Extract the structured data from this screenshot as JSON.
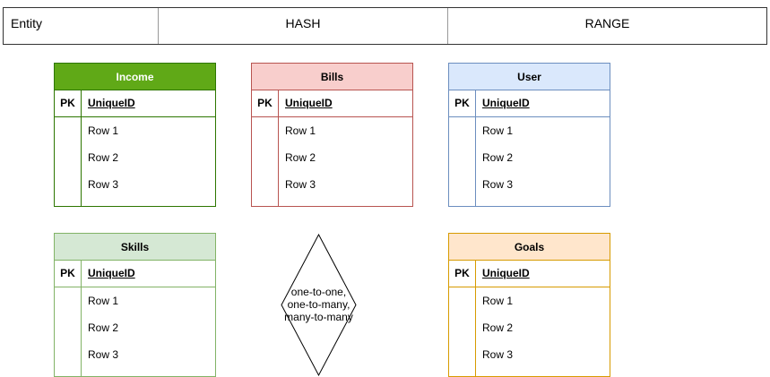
{
  "header": {
    "col1": "Entity",
    "col2": "HASH",
    "col3": "RANGE"
  },
  "entities": [
    {
      "title": "Income",
      "pk_label": "PK",
      "pk_field": "UniqueID",
      "rows": [
        "Row 1",
        "Row 2",
        "Row 3"
      ],
      "colors": {
        "fill": "#60a917",
        "stroke": "#2d7600",
        "title_text": "#ffffff"
      }
    },
    {
      "title": "Bills",
      "pk_label": "PK",
      "pk_field": "UniqueID",
      "rows": [
        "Row 1",
        "Row 2",
        "Row 3"
      ],
      "colors": {
        "fill": "#f8cecc",
        "stroke": "#b85450",
        "title_text": "#000000"
      }
    },
    {
      "title": "User",
      "pk_label": "PK",
      "pk_field": "UniqueID",
      "rows": [
        "Row 1",
        "Row 2",
        "Row 3"
      ],
      "colors": {
        "fill": "#dae8fc",
        "stroke": "#6c8ebf",
        "title_text": "#000000"
      }
    },
    {
      "title": "Skills",
      "pk_label": "PK",
      "pk_field": "UniqueID",
      "rows": [
        "Row 1",
        "Row 2",
        "Row 3"
      ],
      "colors": {
        "fill": "#d5e8d4",
        "stroke": "#82b366",
        "title_text": "#000000"
      }
    },
    {
      "title": "Goals",
      "pk_label": "PK",
      "pk_field": "UniqueID",
      "rows": [
        "Row 1",
        "Row 2",
        "Row 3"
      ],
      "colors": {
        "fill": "#ffe6cc",
        "stroke": "#d79b00",
        "title_text": "#000000"
      }
    }
  ],
  "relationship": {
    "lines": [
      "one-to-one,",
      "one-to-many,",
      "many-to-many"
    ]
  }
}
